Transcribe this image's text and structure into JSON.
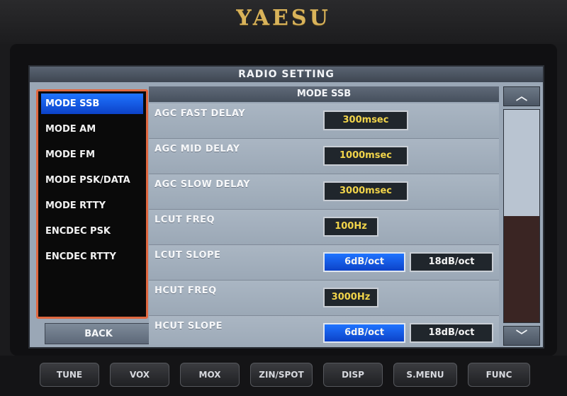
{
  "brand": "YAESU",
  "screen": {
    "title": "RADIO SETTING",
    "back_label": "BACK",
    "scroll_up": "︿",
    "scroll_down": "﹀",
    "scroll_position": 0.5
  },
  "sidebar": {
    "items": [
      {
        "label": "MODE SSB",
        "selected": true
      },
      {
        "label": "MODE AM",
        "selected": false
      },
      {
        "label": "MODE FM",
        "selected": false
      },
      {
        "label": "MODE PSK/DATA",
        "selected": false
      },
      {
        "label": "MODE RTTY",
        "selected": false
      },
      {
        "label": "ENCDEC PSK",
        "selected": false
      },
      {
        "label": "ENCDEC RTTY",
        "selected": false
      }
    ]
  },
  "content": {
    "header": "MODE SSB",
    "rows": [
      {
        "label": "AGC FAST DELAY",
        "value": "300msec"
      },
      {
        "label": "AGC MID DELAY",
        "value": "1000msec"
      },
      {
        "label": "AGC SLOW DELAY",
        "value": "3000msec"
      },
      {
        "label": "LCUT FREQ",
        "value": "100Hz"
      },
      {
        "label": "LCUT SLOPE",
        "options": [
          "6dB/oct",
          "18dB/oct"
        ],
        "selected": "6dB/oct"
      },
      {
        "label": "HCUT FREQ",
        "value": "3000Hz"
      },
      {
        "label": "HCUT SLOPE",
        "options": [
          "6dB/oct",
          "18dB/oct"
        ],
        "selected": "6dB/oct"
      }
    ]
  },
  "hardware_buttons": [
    "TUNE",
    "VOX",
    "MOX",
    "ZIN/SPOT",
    "DISP",
    "S.MENU",
    "FUNC"
  ],
  "colors": {
    "accent_blue": "#1f74ff",
    "value_yellow": "#f1d44a",
    "panel_border": "#e06840",
    "brand_gold": "#d9b35a"
  }
}
